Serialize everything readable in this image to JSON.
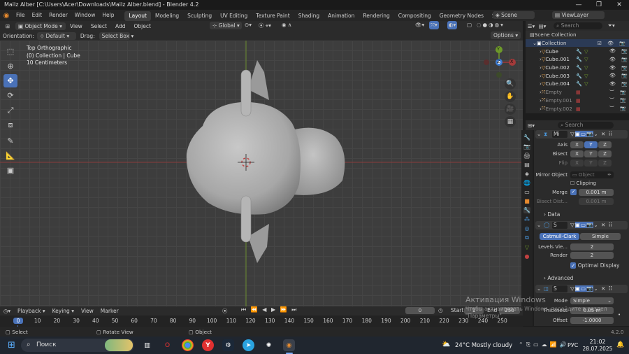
{
  "window": {
    "title": "Mailz Alber [C:\\Users\\Acer\\Downloads\\Mailz Alber.blend] - Blender 4.2",
    "min": "—",
    "max": "❐",
    "close": "✕"
  },
  "menu": [
    "File",
    "Edit",
    "Render",
    "Window",
    "Help"
  ],
  "workspaces": [
    "Layout",
    "Modeling",
    "Sculpting",
    "UV Editing",
    "Texture Paint",
    "Shading",
    "Animation",
    "Rendering",
    "Compositing",
    "Geometry Nodes",
    "Scripting"
  ],
  "scene": "Scene",
  "view_layer": "ViewLayer",
  "viewport_header": {
    "mode": "Object Mode",
    "menus": [
      "View",
      "Select",
      "Add",
      "Object"
    ],
    "transform": "Global",
    "orientation_label": "Orientation:",
    "orientation": "Default",
    "drag_label": "Drag:",
    "drag": "Select Box",
    "options": "Options"
  },
  "viewport_info": {
    "line1": "Top Orthographic",
    "line2": "(0) Collection | Cube",
    "line3": "10 Centimeters"
  },
  "gizmo": {
    "y": "Y",
    "z": "Z",
    "x": "X"
  },
  "outliner": {
    "search_placeholder": "Search",
    "collection_root": "Scene Collection",
    "collection": "Collection",
    "items": [
      {
        "name": "Cube",
        "dim": false
      },
      {
        "name": "Cube.001",
        "dim": false
      },
      {
        "name": "Cube.002",
        "dim": false
      },
      {
        "name": "Cube.003",
        "dim": false
      },
      {
        "name": "Cube.004",
        "dim": false
      },
      {
        "name": "Empty",
        "dim": true
      },
      {
        "name": "Empty.001",
        "dim": true
      },
      {
        "name": "Empty.002",
        "dim": true
      }
    ]
  },
  "properties": {
    "search_placeholder": "Search",
    "mirror": {
      "name": "Mi",
      "axis_label": "Axis",
      "bisect_label": "Bisect",
      "flip_label": "Flip",
      "x": "X",
      "y": "Y",
      "z": "Z",
      "mirror_object_label": "Mirror Object",
      "object_placeholder": "Object",
      "clipping": "Clipping",
      "merge_label": "Merge",
      "merge_value": "0.001 m",
      "bisect_dist_label": "Bisect Dist...",
      "bisect_dist_value": "0.001 m",
      "data": "Data"
    },
    "subsurf": {
      "name": "S",
      "catmull": "Catmull-Clark",
      "simple": "Simple",
      "levels_label": "Levels Vie...",
      "levels_value": "2",
      "render_label": "Render",
      "render_value": "2",
      "optimal": "Optimal Display",
      "advanced": "Advanced"
    },
    "solidify": {
      "name": "S",
      "mode_label": "Mode",
      "mode_value": "Simple",
      "thickness_label": "Thickness",
      "thickness_value": "0.05 m",
      "offset_label": "Offset",
      "offset_value": "-1.0000"
    }
  },
  "timeline": {
    "menus": [
      "Playback",
      "Keying",
      "View",
      "Marker"
    ],
    "current_frame": "0",
    "start_label": "Start",
    "start": "1",
    "end_label": "End",
    "end": "250",
    "ticks": [
      "0",
      "10",
      "20",
      "30",
      "40",
      "50",
      "60",
      "70",
      "80",
      "90",
      "100",
      "110",
      "120",
      "130",
      "140",
      "150",
      "160",
      "170",
      "180",
      "190",
      "200",
      "210",
      "220",
      "230",
      "240",
      "250"
    ]
  },
  "status": {
    "select": "Select",
    "rotate": "Rotate View",
    "object": "Object",
    "version": "4.2.0"
  },
  "watermark": {
    "line1": "Активация Windows",
    "line2": "Чтобы активировать Windows, перейдите в раздел",
    "line3": "\"Параметры\"."
  },
  "taskbar": {
    "search": "Поиск",
    "weather": "24°C  Mostly cloudy",
    "lang": "РУС",
    "time": "21:02",
    "date": "28.07.2025"
  },
  "colors": {
    "accent": "#4a72b8",
    "x_axis": "#a33a3a",
    "y_axis": "#6e9a2a",
    "z_axis": "#3d7bd1"
  }
}
